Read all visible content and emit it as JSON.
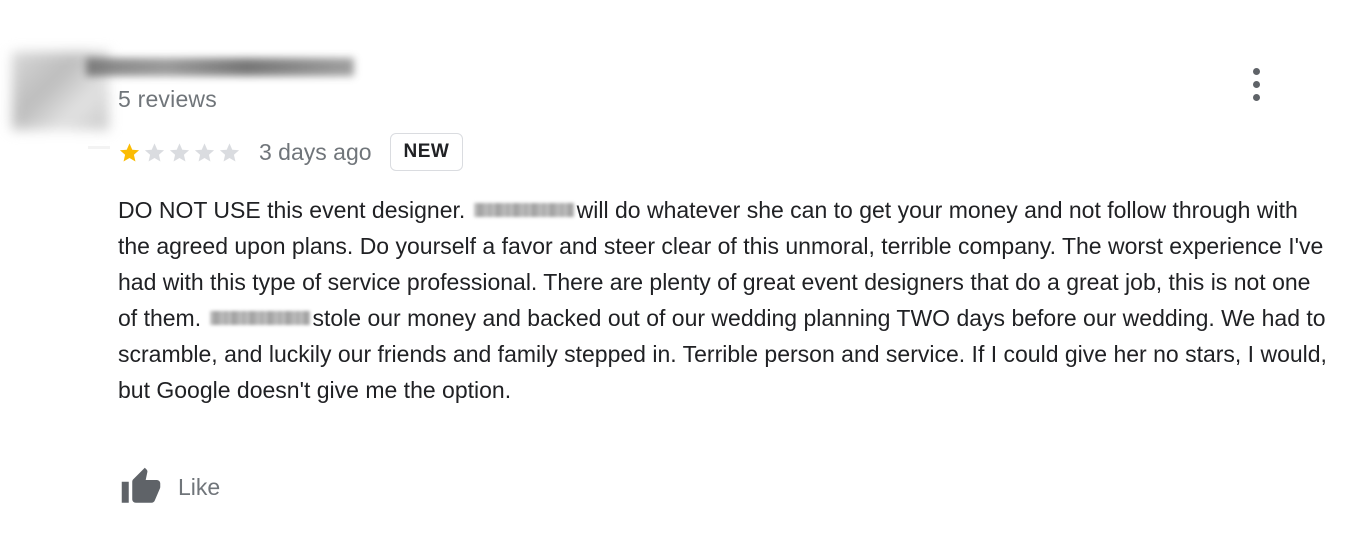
{
  "reviewer": {
    "review_count": "5 reviews"
  },
  "rating": {
    "stars_filled": 1,
    "stars_total": 5,
    "time": "3 days ago",
    "badge": "NEW"
  },
  "review": {
    "part1": "DO NOT USE this event designer.",
    "part2": "will do whatever she can to get your money and not follow through with the agreed upon plans.  Do yourself a favor and steer clear of this unmoral, terrible company.  The worst experience I've had with this type of service professional.  There are plenty of great event designers that do a great job, this is not one of them.",
    "part3": "stole our money and backed out of our wedding planning TWO days before our wedding.  We had to scramble, and luckily our friends and family stepped in.  Terrible person and service.  If I could give her no stars, I would, but Google doesn't give me the option."
  },
  "actions": {
    "like_label": "Like"
  },
  "icons": {
    "menu": "more-vert-icon",
    "like": "thumb-up-icon",
    "star": "star-icon"
  },
  "colors": {
    "star_filled": "#fbbc04",
    "star_empty": "#dadce0",
    "secondary_text": "#70757a",
    "icon_gray": "#5f6368"
  }
}
